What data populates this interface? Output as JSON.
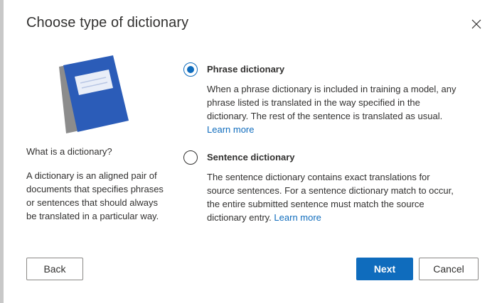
{
  "dialog": {
    "title": "Choose type of dictionary",
    "close_icon": "close-icon"
  },
  "info": {
    "illustration_icon": "notebook-icon",
    "heading": "What is a dictionary?",
    "body": "A dictionary is an aligned pair of documents that specifies phrases or sentences that should always be translated in a particular way."
  },
  "options": [
    {
      "label": "Phrase dictionary",
      "selected": true,
      "description": "When a phrase dictionary is included in training a model, any phrase listed is translated in the way specified in the dictionary. The rest of the sentence is translated as usual.",
      "link": "Learn more"
    },
    {
      "label": "Sentence dictionary",
      "selected": false,
      "description": "The sentence dictionary contains exact translations for source sentences. For a sentence dictionary match to occur, the entire submitted sentence must match the source dictionary entry.",
      "link": "Learn more"
    }
  ],
  "footer": {
    "back_label": "Back",
    "next_label": "Next",
    "cancel_label": "Cancel"
  },
  "colors": {
    "accent": "#0f6cbd",
    "book_cover": "#2b5cb8",
    "book_spine": "#8c8c8c"
  }
}
